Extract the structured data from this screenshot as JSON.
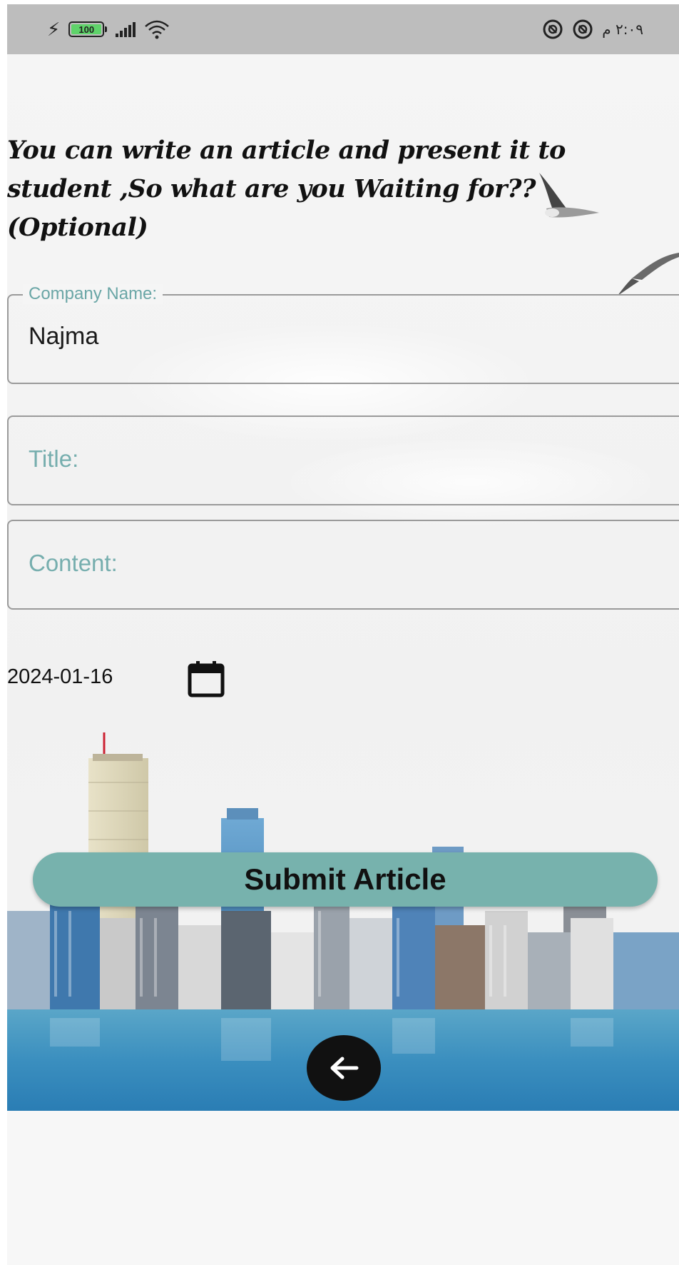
{
  "status_bar": {
    "battery_level": "100",
    "time": "٢:٠٩ م"
  },
  "page": {
    "heading": "You can write an article and present it to student ,So what are you Waiting for??(Optional)"
  },
  "form": {
    "company_name": {
      "label": "Company Name:",
      "value": "Najma"
    },
    "title": {
      "placeholder": "Title:"
    },
    "content": {
      "placeholder": "Content:"
    },
    "date": {
      "value": "2024-01-16",
      "icon": "calendar-icon"
    },
    "submit_label": "Submit Article"
  },
  "navigation": {
    "back_icon": "arrow-left-icon"
  },
  "colors": {
    "accent": "#77b2ad",
    "label": "#6aa6a6",
    "status_bar": "#bdbdbd"
  }
}
